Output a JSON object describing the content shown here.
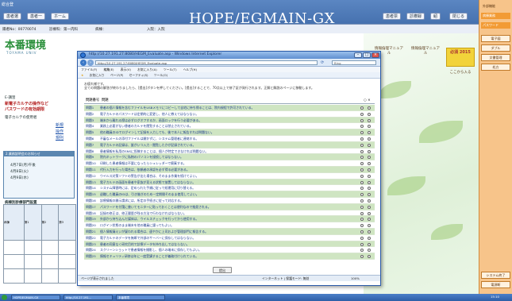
{
  "app": {
    "title": "HOPE/EGMAIN-GX",
    "menu_label": "総合登",
    "top_buttons": [
      "患者選",
      "患者一",
      "ホーム"
    ],
    "right_buttons": [
      "患者票",
      "診療録",
      "紹",
      "閉じる"
    ],
    "subrow": [
      "陽者No：00770074",
      "診療科：第一内科",
      "病棟：",
      "入院：入院"
    ]
  },
  "right_bar": {
    "items": [
      "外部機能",
      "病棟業務",
      "パスワード",
      "電子図",
      "ダブル",
      "文書管理",
      "処方"
    ],
    "highlight_index": 1,
    "bottom_buttons": [
      "システム終了",
      "電源断"
    ]
  },
  "bg_page": {
    "logo": "本番環境",
    "logo_sub": "TOYAMA UNIV",
    "heading_small": "E-講習",
    "heading_red": "新電子カルテの操作など",
    "heading_red2": "パスワードの有効期限",
    "note": "電子カルテの使用者",
    "links": [
      "新規",
      "操作",
      "規則"
    ],
    "box_title": "2.業務説明会のお知らせ",
    "box_lines": [
      "4月7日(月)午後",
      "4月8日(火)",
      "4月9日(水)"
    ],
    "table_title": "病棟別診療部門設置",
    "table_head": [
      "病棟",
      "第1",
      "第2",
      "第3"
    ]
  },
  "bg_right": {
    "promo1": "情報倫理マニュアル",
    "promo2": "情報倫理マニュアル",
    "promo_yellow": "必須 2015",
    "promo_sub": "ここから入る"
  },
  "ie": {
    "title": "http://10.27.191.27:8080/HEGM_Evaluate.asp - Windows Internet Explorer",
    "address": "http://10.27.191.27:8080/HEGM_Evaluate.asp",
    "search_placeholder": "Bing",
    "menu": [
      "ファイル(F)",
      "編集(E)",
      "表示(V)",
      "お気に入り(A)",
      "ツール(T)",
      "ヘルプ(H)"
    ],
    "fav": [
      "お気に入り",
      "ページ(P)",
      "セーフティ(S)",
      "ツール(O)"
    ],
    "intro1": "お疲れ様です。",
    "intro2": "全ての問題の解答が終わりましたら、[提出]ボタンを押してください。[提出]することで、70点以上で修了証が発行されます。正解と解説のページに移動します。",
    "intro3": "",
    "header_num": "問題番号",
    "header_q": "問題",
    "header_ans": "○ ×",
    "questions": [
      {
        "n": "問題1",
        "q": "患者の個人情報を含むファイルをUSBメモリにコピーして自宅に持ち帰ることは、院内規程で許可されている。",
        "g": true
      },
      {
        "n": "問題2",
        "q": "電子カルテのパスワードは定期的に変更し、他人に教えてはならない。",
        "g": false
      },
      {
        "n": "問題3",
        "q": "端末から離れる際は必ずログオフするか、画面ロックを行う必要がある。",
        "g": true
      },
      {
        "n": "問題4",
        "q": "業務上必要がない患者のカルテを閲覧することは禁止されている。",
        "g": false
      },
      {
        "n": "問題5",
        "q": "他の職員のIDでログインして記録を入力しても、後で本人に報告すれば問題ない。",
        "g": true
      },
      {
        "n": "問題6",
        "q": "不審なメールの添付ファイルは開かずに、システム管理者に連絡する。",
        "g": false
      },
      {
        "n": "問題7",
        "q": "電子カルテの記録は、誰がいつ入力・閲覧したかが記録されている。",
        "g": true
      },
      {
        "n": "問題8",
        "q": "患者情報を私用のSNSに投稿することは、個人が特定できなければ問題ない。",
        "g": false
      },
      {
        "n": "問題9",
        "q": "院内ネットワークに私物のパソコンを接続してはならない。",
        "g": true
      },
      {
        "n": "問題10",
        "q": "印刷した患者情報は不要になったらシュレッダーで廃棄する。",
        "g": false
      },
      {
        "n": "問題11",
        "q": "代行入力を行った場合は、依頼者の承認を必ず得る必要がある。",
        "g": true
      },
      {
        "n": "問題12",
        "q": "ウイルス対策ソフトの警告が出た場合は、そのまま作業を続けてよい。",
        "g": false
      },
      {
        "n": "問題13",
        "q": "電子カルテの画面を患者や家族が見える状態で放置してはならない。",
        "g": true
      },
      {
        "n": "問題14",
        "q": "システム障害時には、定められた手順に従って紙運用に切り替える。",
        "g": false
      },
      {
        "n": "問題15",
        "q": "退職した職員のIDは、引き継ぎのため一定期間そのまま使用してよい。",
        "g": true
      },
      {
        "n": "問題16",
        "q": "診療情報の開示請求には、所定の手続きに従って対応する。",
        "g": false
      },
      {
        "n": "問題17",
        "q": "パスワードを付箋に書いてモニターに貼っておくことは便利なので推奨される。",
        "g": true
      },
      {
        "n": "問題18",
        "q": "記録の修正は、修正履歴が残る方法で行わなければならない。",
        "g": false
      },
      {
        "n": "問題19",
        "q": "外部から持ち込んだ媒体は、ウイルスチェックを行ってから使用する。",
        "g": true
      },
      {
        "n": "問題20",
        "q": "ログイン状態のまま端末を他の職員に譲ってもよい。",
        "g": false
      },
      {
        "n": "問題21",
        "q": "個人情報漏えいが疑われる場合は、速やかに上司および管理部門に報告する。",
        "g": true
      },
      {
        "n": "問題22",
        "q": "電子カルテのデータを無断で外部のサーバーに保存してはならない。",
        "g": false
      },
      {
        "n": "問題23",
        "q": "患者の同意なく研究目的で診療データを持ち出してはならない。",
        "g": true
      },
      {
        "n": "問題24",
        "q": "スクリーンショットで患者情報を撮影し、個人の端末に保存してもよい。",
        "g": false
      },
      {
        "n": "問題25",
        "q": "情報セキュリティ研修は年に一度受講することが義務付けられている。",
        "g": true
      }
    ],
    "submit": "提出",
    "status_left": "ページが表示されました",
    "status_mid": "インターネット | 保護モード: 無効",
    "status_zoom": "100%"
  },
  "taskbar": {
    "items": [
      "HOPE/EGMAIN-GX",
      "http://10.27.191...",
      "本番環境"
    ],
    "clock": "15:10"
  },
  "colors": {
    "host_header": "#4a78b8",
    "question_green": "#cfe5c2",
    "right_bar": "#f7c48a",
    "logo_green": "#2a8f3a"
  }
}
